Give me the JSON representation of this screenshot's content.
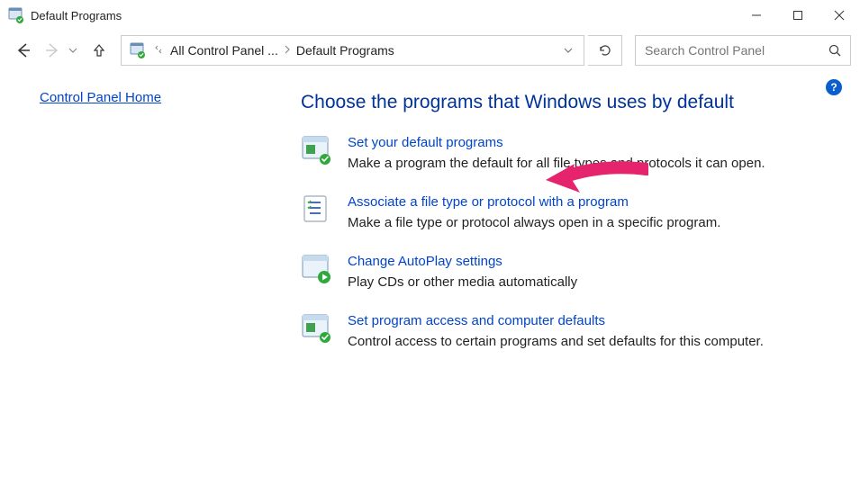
{
  "window": {
    "title": "Default Programs"
  },
  "address": {
    "crumb1": "All Control Panel ...",
    "crumb2": "Default Programs"
  },
  "search": {
    "placeholder": "Search Control Panel"
  },
  "sidebar": {
    "home_link": "Control Panel Home"
  },
  "main": {
    "heading": "Choose the programs that Windows uses by default",
    "options": [
      {
        "link": "Set your default programs",
        "desc": "Make a program the default for all file types and protocols it can open."
      },
      {
        "link": "Associate a file type or protocol with a program",
        "desc": "Make a file type or protocol always open in a specific program."
      },
      {
        "link": "Change AutoPlay settings",
        "desc": "Play CDs or other media automatically"
      },
      {
        "link": "Set program access and computer defaults",
        "desc": "Control access to certain programs and set defaults for this computer."
      }
    ]
  },
  "help": {
    "label": "?"
  }
}
